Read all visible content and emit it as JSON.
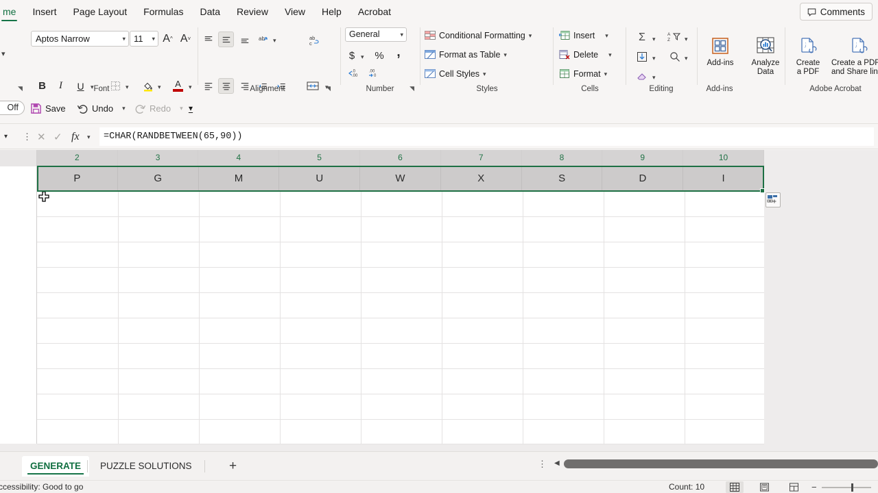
{
  "window": {
    "tabs": [
      {
        "label": "me",
        "active": true
      },
      {
        "label": "Insert",
        "active": false
      },
      {
        "label": "Page Layout",
        "active": false
      },
      {
        "label": "Formulas",
        "active": false
      },
      {
        "label": "Data",
        "active": false
      },
      {
        "label": "Review",
        "active": false
      },
      {
        "label": "View",
        "active": false
      },
      {
        "label": "Help",
        "active": false
      },
      {
        "label": "Acrobat",
        "active": false
      }
    ],
    "comments_label": "Comments"
  },
  "ribbon": {
    "font": {
      "group_label": "Font",
      "font_name": "Aptos Narrow",
      "font_size": "11",
      "grow_font": "A",
      "shrink_font": "A",
      "bold": "B",
      "italic": "I",
      "underline": "U"
    },
    "alignment": {
      "group_label": "Alignment"
    },
    "number": {
      "group_label": "Number",
      "format": "General",
      "currency": "$",
      "percent": "%",
      "comma": ","
    },
    "styles": {
      "group_label": "Styles",
      "conditional_formatting": "Conditional Formatting",
      "format_as_table": "Format as Table",
      "cell_styles": "Cell Styles"
    },
    "cells": {
      "group_label": "Cells",
      "insert": "Insert",
      "delete": "Delete",
      "format": "Format"
    },
    "editing": {
      "group_label": "Editing"
    },
    "addins": {
      "group_label": "Add-ins",
      "button": "Add-ins",
      "analyze_line1": "Analyze",
      "analyze_line2": "Data"
    },
    "acrobat": {
      "group_label": "Adobe Acrobat",
      "create_pdf_line1": "Create",
      "create_pdf_line2": "a PDF",
      "share_line1": "Create a PDF",
      "share_line2": "and Share link"
    }
  },
  "quick_access": {
    "autosave": "Off",
    "save": "Save",
    "undo": "Undo",
    "redo": "Redo"
  },
  "formula_bar": {
    "formula": "=CHAR(RANDBETWEEN(65,90))"
  },
  "grid": {
    "column_headers": [
      "2",
      "3",
      "4",
      "5",
      "6",
      "7",
      "8",
      "9",
      "10"
    ],
    "selected_row_values": [
      "P",
      "G",
      "M",
      "U",
      "W",
      "X",
      "S",
      "D",
      "I"
    ]
  },
  "sheet_tabs": {
    "tabs": [
      {
        "label": "GENERATE",
        "active": true
      },
      {
        "label": "PUZZLE SOLUTIONS",
        "active": false
      }
    ],
    "add_label": "+"
  },
  "status_bar": {
    "accessibility": "Accessibility: Good to go",
    "count": "Count: 10",
    "zoom_minus": "−"
  },
  "colors": {
    "excel_green": "#217346",
    "selection_green": "#1d7044",
    "header_text": "#217346"
  }
}
